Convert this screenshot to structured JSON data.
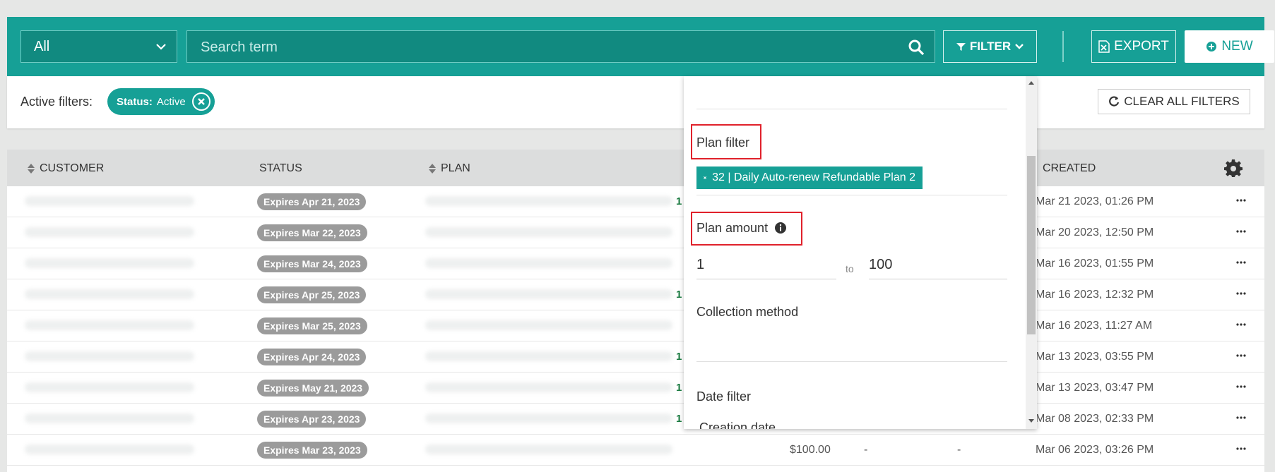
{
  "toolbar": {
    "scope_select": "All",
    "search_placeholder": "Search term",
    "filter_label": "FILTER",
    "export_label": "EXPORT",
    "new_label": "NEW",
    "accent": "#16a096"
  },
  "filters": {
    "label": "Active filters:",
    "chip_key": "Status:",
    "chip_value": "Active",
    "clear_label": "CLEAR ALL FILTERS"
  },
  "table": {
    "columns": [
      "CUSTOMER",
      "STATUS",
      "PLAN",
      "CREATED"
    ],
    "rows": [
      {
        "status": "Expires Apr 21, 2023",
        "plan_num": "1",
        "created": "Mar 21 2023, 01:26 PM"
      },
      {
        "status": "Expires Mar 22, 2023",
        "plan_num": "",
        "created": "Mar 20 2023, 12:50 PM"
      },
      {
        "status": "Expires Mar 24, 2023",
        "plan_num": "",
        "created": "Mar 16 2023, 01:55 PM"
      },
      {
        "status": "Expires Apr 25, 2023",
        "plan_num": "1",
        "created": "Mar 16 2023, 12:32 PM"
      },
      {
        "status": "Expires Mar 25, 2023",
        "plan_num": "",
        "created": "Mar 16 2023, 11:27 AM"
      },
      {
        "status": "Expires Apr 24, 2023",
        "plan_num": "1",
        "created": "Mar 13 2023, 03:55 PM"
      },
      {
        "status": "Expires May 21, 2023",
        "plan_num": "1",
        "created": "Mar 13 2023, 03:47 PM"
      },
      {
        "status": "Expires Apr 23, 2023",
        "plan_num": "1",
        "created": "Mar 08 2023, 02:33 PM"
      },
      {
        "status": "Expires Mar 23, 2023",
        "plan_num": "",
        "created": "Mar 06 2023, 03:26 PM",
        "amount": "$100.00",
        "dash1": "-",
        "dash2": "-"
      }
    ]
  },
  "panel": {
    "plan_filter_label": "Plan filter",
    "plan_tag": "32 | Daily Auto-renew Refundable Plan 2",
    "plan_amount_label": "Plan amount",
    "amount_from": "1",
    "amount_to_word": "to",
    "amount_to": "100",
    "collection_label": "Collection method",
    "date_filter_label": "Date filter",
    "date_sub_label": "Creation date"
  }
}
